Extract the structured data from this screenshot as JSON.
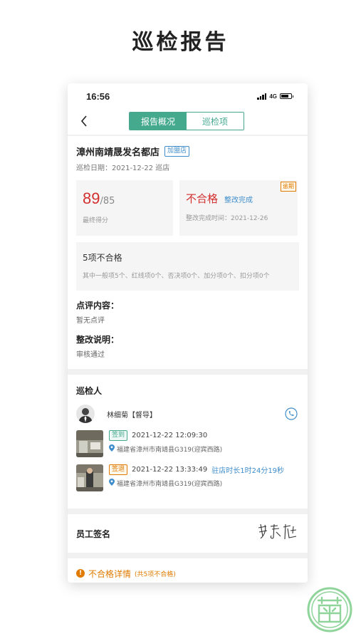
{
  "page_title": "巡检报告",
  "status_bar": {
    "time": "16:56",
    "network": "4G"
  },
  "nav": {
    "back_icon": "chevron-left-icon",
    "tabs": [
      {
        "label": "报告概况",
        "active": true
      },
      {
        "label": "巡检项",
        "active": false
      }
    ]
  },
  "report": {
    "store_name": "漳州南靖晟发名都店",
    "store_badge": "加盟店",
    "date_line": "巡检日期：2021-12-22  巡店",
    "score": {
      "value": "89",
      "total": "/85",
      "label": "最终得分"
    },
    "result": {
      "status": "不合格",
      "rectify_status": "整改完成",
      "overdue_tag": "逾期",
      "rectify_time": "整改完成时间：2021-12-26"
    },
    "summary": {
      "title": "5项不合格",
      "detail": "其中一般项5个、红线项0个、否决项0个、加分项0个、扣分项0个"
    },
    "comment": {
      "label": "点评内容：",
      "value": "暂无点评"
    },
    "rectify_note": {
      "label": "整改说明：",
      "value": "审核通过"
    }
  },
  "inspector": {
    "section_title": "巡检人",
    "name": "林细菊【督导】",
    "records": [
      {
        "tag": "签到",
        "time": "2021-12-22 12:09:30",
        "stay": "",
        "address": "福建省漳州市南靖县G319(迎宾西路)"
      },
      {
        "tag": "签退",
        "time": "2021-12-22 13:33:49",
        "stay": "驻店时长1时24分19秒",
        "address": "福建省漳州市南靖县G319(迎宾西路)"
      }
    ]
  },
  "signature": {
    "label": "员工签名"
  },
  "fail_detail": {
    "label": "不合格详情",
    "count": "(共5项不合格)"
  },
  "colors": {
    "accent": "#45a98e",
    "danger": "#d32f2f",
    "link": "#3f8ecb",
    "warning": "#e07b00"
  }
}
